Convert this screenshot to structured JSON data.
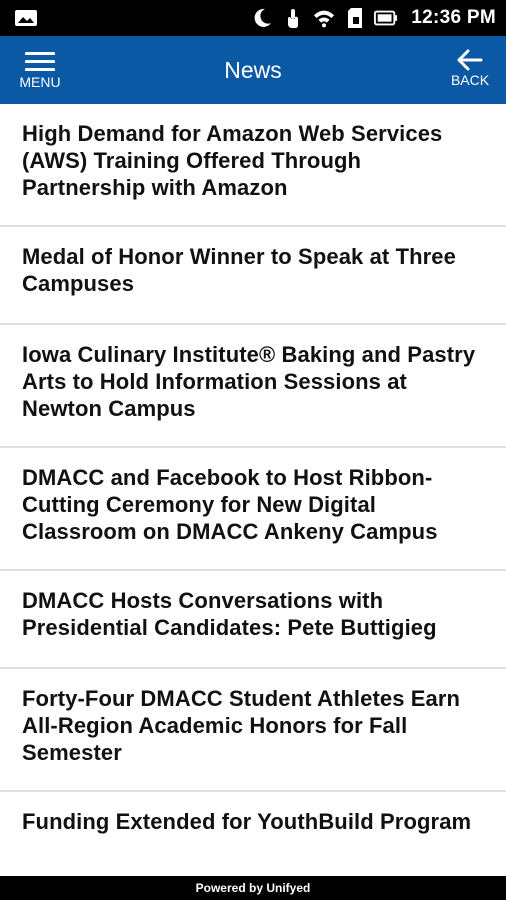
{
  "status_bar": {
    "time": "12:36 PM",
    "icons": [
      "photo-icon",
      "moon-icon",
      "touch-icon",
      "wifi-icon",
      "sd-card-icon",
      "battery-icon"
    ]
  },
  "header": {
    "menu_label": "MENU",
    "title": "News",
    "back_label": "BACK",
    "background_color": "#0b58a5"
  },
  "news": {
    "items": [
      {
        "title": "High Demand for Amazon Web Services (AWS) Training Offered Through Partnership with Amazon"
      },
      {
        "title": "Medal of Honor Winner to Speak at Three Campuses"
      },
      {
        "title": "Iowa Culinary Institute® Baking and Pastry Arts to Hold Information Sessions at Newton Campus"
      },
      {
        "title": "DMACC and Facebook to Host Ribbon-Cutting Ceremony for New Digital Classroom on DMACC Ankeny Campus"
      },
      {
        "title": "DMACC Hosts Conversations with Presidential Candidates: Pete Buttigieg"
      },
      {
        "title": "Forty-Four DMACC Student Athletes Earn All-Region Academic Honors for Fall Semester"
      },
      {
        "title": "Funding Extended for YouthBuild Program"
      }
    ]
  },
  "footer": {
    "text": "Powered by Unifyed"
  }
}
